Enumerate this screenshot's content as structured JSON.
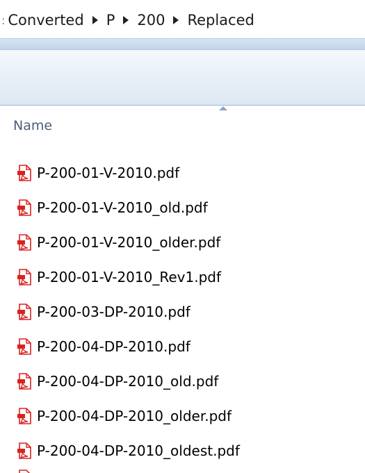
{
  "breadcrumb": {
    "lead": ":",
    "segments": [
      "Converted",
      "P",
      "200",
      "Replaced"
    ]
  },
  "columns": {
    "name_label": "Name",
    "sort": "ascending"
  },
  "files": [
    {
      "name": "P-200-01-V-2010.pdf",
      "icon": "pdf-icon"
    },
    {
      "name": "P-200-01-V-2010_old.pdf",
      "icon": "pdf-icon"
    },
    {
      "name": "P-200-01-V-2010_older.pdf",
      "icon": "pdf-icon"
    },
    {
      "name": "P-200-01-V-2010_Rev1.pdf",
      "icon": "pdf-icon"
    },
    {
      "name": "P-200-03-DP-2010.pdf",
      "icon": "pdf-icon"
    },
    {
      "name": "P-200-04-DP-2010.pdf",
      "icon": "pdf-icon"
    },
    {
      "name": "P-200-04-DP-2010_old.pdf",
      "icon": "pdf-icon"
    },
    {
      "name": "P-200-04-DP-2010_older.pdf",
      "icon": "pdf-icon"
    },
    {
      "name": "P-200-04-DP-2010_oldest.pdf",
      "icon": "pdf-icon"
    }
  ],
  "colors": {
    "pdf_red": "#d8231f",
    "header_text": "#4c607a",
    "toolbar_top": "#f5f9fd",
    "toolbar_bottom": "#dde8f4"
  }
}
